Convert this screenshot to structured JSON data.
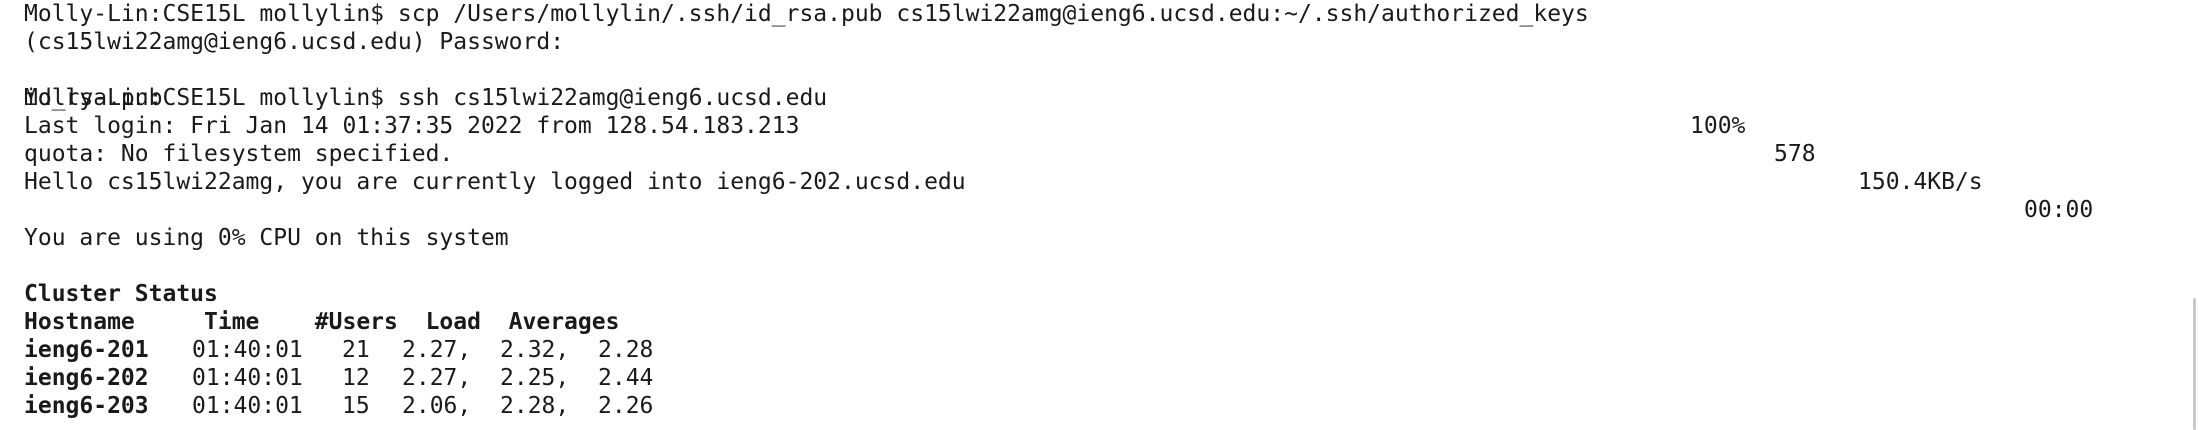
{
  "terminal": {
    "lines": {
      "l0": "Molly-Lin:CSE15L mollylin$ scp /Users/mollylin/.ssh/id_rsa.pub cs15lwi22amg@ieng6.ucsd.edu:~/.ssh/authorized_keys",
      "l1": "(cs15lwi22amg@ieng6.ucsd.edu) Password:",
      "l2_file": "id_rsa.pub",
      "l2_progress": "100%",
      "l2_size": "578",
      "l2_rate": "150.4KB/s",
      "l2_eta": "00:00",
      "l3": "Molly-Lin:CSE15L mollylin$ ssh cs15lwi22amg@ieng6.ucsd.edu",
      "l4": "Last login: Fri Jan 14 01:37:35 2022 from 128.54.183.213",
      "l5": "quota: No filesystem specified.",
      "l6": "Hello cs15lwi22amg, you are currently logged into ieng6-202.ucsd.edu",
      "l8": "You are using 0% CPU on this system",
      "l10": "Cluster Status",
      "l11": "Hostname     Time    #Users  Load  Averages"
    },
    "cluster": [
      {
        "host": "ieng6-201",
        "time": "01:40:01",
        "users": "21",
        "load1": "2.27,",
        "load5": "2.32,",
        "load15": "2.28"
      },
      {
        "host": "ieng6-202",
        "time": "01:40:01",
        "users": "12",
        "load1": "2.27,",
        "load5": "2.25,",
        "load15": "2.44"
      },
      {
        "host": "ieng6-203",
        "time": "01:40:01",
        "users": "15",
        "load1": "2.06,",
        "load5": "2.28,",
        "load15": "2.26"
      }
    ]
  }
}
